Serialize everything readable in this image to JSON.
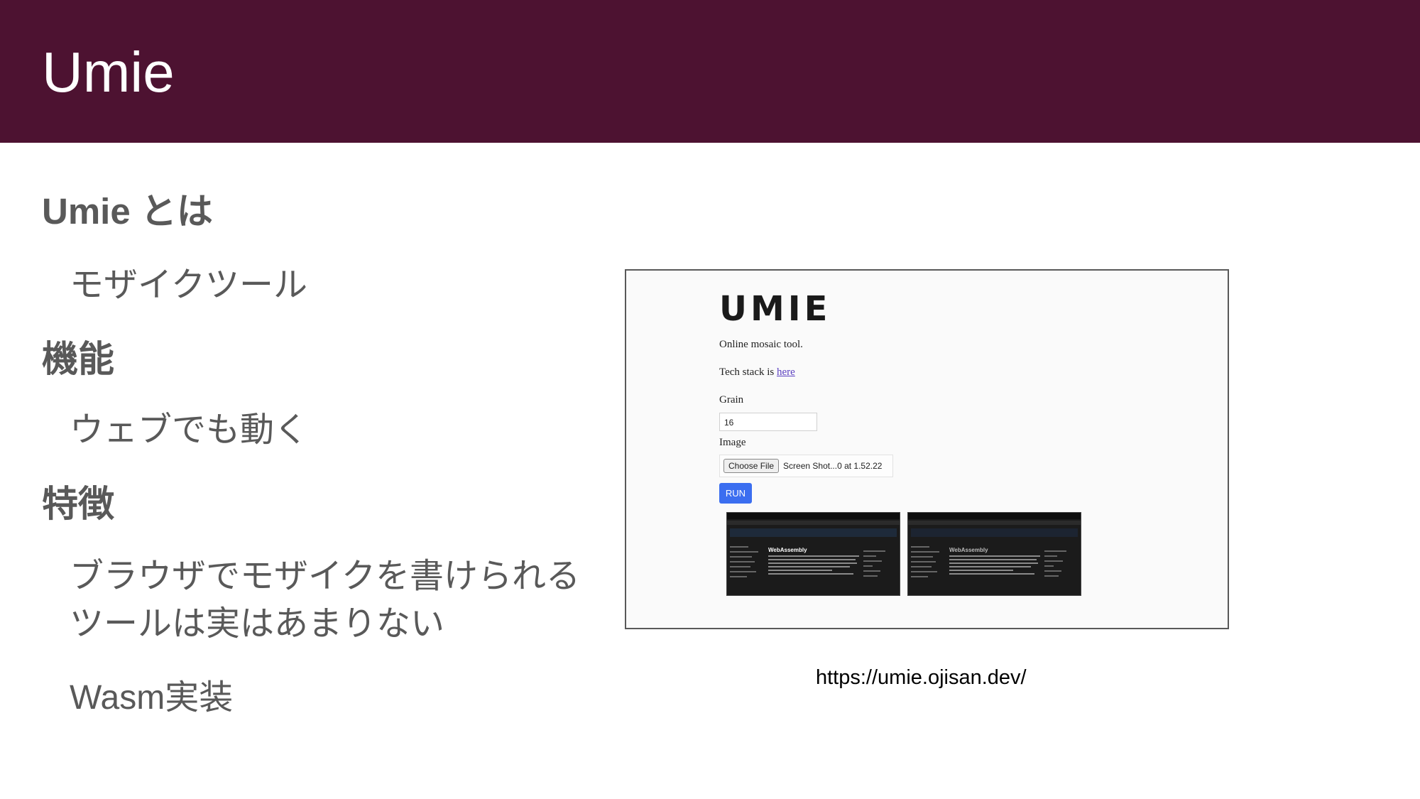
{
  "slide": {
    "title": "Umie"
  },
  "sections": [
    {
      "heading": "Umie とは",
      "bullets": [
        "モザイクツール"
      ]
    },
    {
      "heading": "機能",
      "bullets": [
        "ウェブでも動く"
      ]
    },
    {
      "heading": "特徴",
      "bullets": [
        "ブラウザでモザイクを書けられる",
        "ツールは実はあまりない",
        "Wasm実装"
      ]
    }
  ],
  "screenshot": {
    "logo": "UMIE",
    "tagline": "Online mosaic tool.",
    "tech_prefix": "Tech stack is ",
    "tech_link": "here",
    "grain_label": "Grain",
    "grain_value": "16",
    "image_label": "Image",
    "choose_file": "Choose File",
    "file_name": "Screen Shot...0 at 1.52.22",
    "run": "RUN",
    "thumb1_title": "WebAssembly",
    "thumb2_title": "WebAssembly"
  },
  "caption": "https://umie.ojisan.dev/"
}
